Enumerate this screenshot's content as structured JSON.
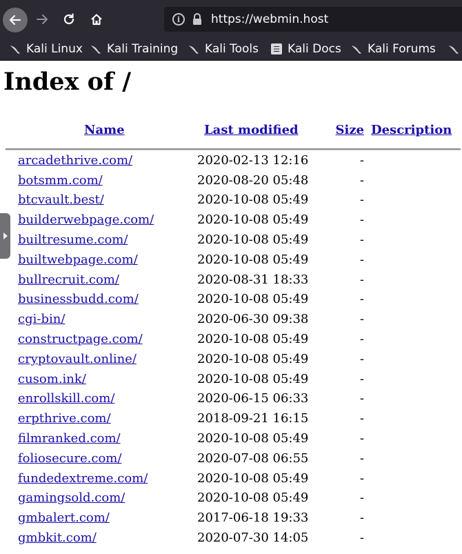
{
  "browser": {
    "url": "https://webmin.host",
    "nav": {
      "back_icon": "arrow-left-icon",
      "forward_icon": "arrow-right-icon",
      "reload_icon": "reload-icon",
      "home_icon": "home-icon"
    },
    "urlbar_icons": [
      "info-icon",
      "lock-icon"
    ],
    "bookmarks": [
      {
        "label": "Kali Linux",
        "icon": "kali-dragon-icon"
      },
      {
        "label": "Kali Training",
        "icon": "kali-dragon-icon"
      },
      {
        "label": "Kali Tools",
        "icon": "kali-dragon-icon"
      },
      {
        "label": "Kali Docs",
        "icon": "kali-docs-icon"
      },
      {
        "label": "Kali Forums",
        "icon": "kali-dragon-icon"
      }
    ],
    "colors": {
      "toolbar": "#2b2a33",
      "urlbar": "#1c1b22",
      "link": "#1a0dab"
    }
  },
  "page": {
    "title": "Index of /",
    "headers": {
      "name": "Name",
      "last_modified": "Last modified",
      "size": "Size",
      "description": "Description"
    },
    "entries": [
      {
        "name": "arcadethrive.com/",
        "modified": "2020-02-13 12:16",
        "size": "-"
      },
      {
        "name": "botsmm.com/",
        "modified": "2020-08-20 05:48",
        "size": "-"
      },
      {
        "name": "btcvault.best/",
        "modified": "2020-10-08 05:49",
        "size": "-"
      },
      {
        "name": "builderwebpage.com/",
        "modified": "2020-10-08 05:49",
        "size": "-"
      },
      {
        "name": "builtresume.com/",
        "modified": "2020-10-08 05:49",
        "size": "-"
      },
      {
        "name": "builtwebpage.com/",
        "modified": "2020-10-08 05:49",
        "size": "-"
      },
      {
        "name": "bullrecruit.com/",
        "modified": "2020-08-31 18:33",
        "size": "-"
      },
      {
        "name": "businessbudd.com/",
        "modified": "2020-10-08 05:49",
        "size": "-"
      },
      {
        "name": "cgi-bin/",
        "modified": "2020-06-30 09:38",
        "size": "-"
      },
      {
        "name": "constructpage.com/",
        "modified": "2020-10-08 05:49",
        "size": "-"
      },
      {
        "name": "cryptovault.online/",
        "modified": "2020-10-08 05:49",
        "size": "-"
      },
      {
        "name": "cusom.ink/",
        "modified": "2020-10-08 05:49",
        "size": "-"
      },
      {
        "name": "enrollskill.com/",
        "modified": "2020-06-15 06:33",
        "size": "-"
      },
      {
        "name": "erpthrive.com/",
        "modified": "2018-09-21 16:15",
        "size": "-"
      },
      {
        "name": "filmranked.com/",
        "modified": "2020-10-08 05:49",
        "size": "-"
      },
      {
        "name": "foliosecure.com/",
        "modified": "2020-07-08 06:55",
        "size": "-"
      },
      {
        "name": "fundedextreme.com/",
        "modified": "2020-10-08 05:49",
        "size": "-"
      },
      {
        "name": "gamingsold.com/",
        "modified": "2020-10-08 05:49",
        "size": "-"
      },
      {
        "name": "gmbalert.com/",
        "modified": "2017-06-18 19:33",
        "size": "-"
      },
      {
        "name": "gmbkit.com/",
        "modified": "2020-07-30 14:05",
        "size": "-"
      }
    ]
  }
}
